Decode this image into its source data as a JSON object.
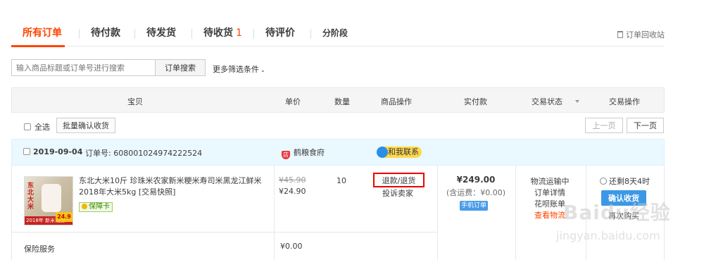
{
  "tabs": [
    {
      "label": "所有订单",
      "active": true
    },
    {
      "label": "待付款"
    },
    {
      "label": "待发货"
    },
    {
      "label": "待收货",
      "count": "1"
    },
    {
      "label": "待评价"
    },
    {
      "label": "分阶段"
    }
  ],
  "recycle_label": "订单回收站",
  "search": {
    "placeholder": "输入商品标题或订单号进行搜索",
    "button": "订单搜索",
    "more_filters": "更多筛选条件"
  },
  "columns": [
    "宝贝",
    "单价",
    "数量",
    "商品操作",
    "实付款",
    "交易状态",
    "交易操作"
  ],
  "select_all": "全选",
  "batch_confirm": "批量确认收货",
  "pagination": {
    "prev": "上一页",
    "next": "下一页"
  },
  "order": {
    "date": "2019-09-04",
    "order_no": "订单号: 608001024974222524",
    "shop": "鹤粮食府",
    "contact": "和我联系",
    "product": {
      "title": "东北大米10斤 珍珠米农家新米粳米寿司米黑龙江鲜米2018年大米5kg [交易快照]",
      "image_text": "东北大米",
      "image_band": "2018年 新米现磨",
      "image_price": "24.9",
      "badge": "保障卡",
      "orig_price": "¥45.90",
      "price": "¥24.90",
      "qty": "10",
      "refund": "退款/退货",
      "complain": "投诉卖家"
    },
    "paid": {
      "amount": "¥249.00",
      "shipping": "(含运费：¥0.00)",
      "mobile": "手机订单"
    },
    "status": [
      "物流运输中",
      "订单详情",
      "花呗账单",
      "查看物流"
    ],
    "remain": "还剩8天4时",
    "confirm": "确认收货",
    "again": "再次购买",
    "insurance": "保险服务",
    "insurance_price": "¥0.00"
  },
  "watermark": {
    "logo": "Baidu经验",
    "url": "jingyan.baidu.com"
  },
  "colors": {
    "accent": "#ff4400",
    "order_head_bg": "#eaf8ff",
    "confirm_btn": "#3c98e6"
  }
}
